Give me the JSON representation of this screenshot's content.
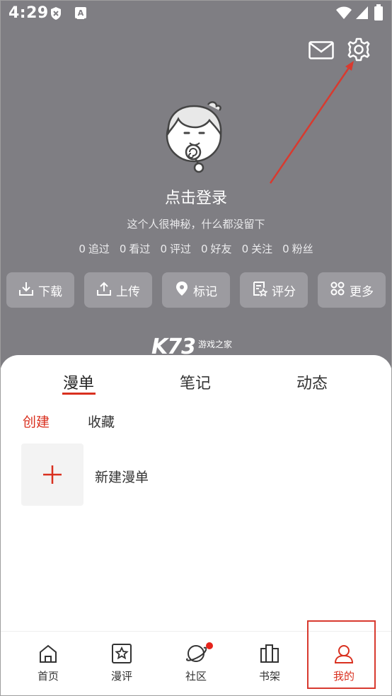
{
  "status_bar": {
    "time": "4:29",
    "icons": [
      "shield-x-icon",
      "a-keyboard-icon",
      "wifi-icon",
      "signal-icon",
      "battery-icon"
    ]
  },
  "header_icons": [
    "mail-icon",
    "settings-gear-icon"
  ],
  "profile": {
    "login_label": "点击登录",
    "bio": "这个人很神秘，什么都没留下"
  },
  "stats": [
    {
      "count": "0",
      "label": "追过"
    },
    {
      "count": "0",
      "label": "看过"
    },
    {
      "count": "0",
      "label": "评过"
    },
    {
      "count": "0",
      "label": "好友"
    },
    {
      "count": "0",
      "label": "关注"
    },
    {
      "count": "0",
      "label": "粉丝"
    }
  ],
  "actions": [
    {
      "label": "下载",
      "icon": "download-icon"
    },
    {
      "label": "上传",
      "icon": "upload-icon"
    },
    {
      "label": "标记",
      "icon": "location-pin-icon"
    },
    {
      "label": "评分",
      "icon": "rate-note-icon"
    },
    {
      "label": "更多",
      "icon": "more-grid-icon"
    }
  ],
  "watermark": {
    "brand": "K73",
    "tagline": "游戏之家"
  },
  "content_tabs": {
    "tabs": [
      "漫单",
      "笔记",
      "动态"
    ],
    "active": "漫单"
  },
  "sub_tabs": {
    "items": [
      "创建",
      "收藏"
    ],
    "active": "创建"
  },
  "create_item": {
    "label": "新建漫单",
    "icon": "plus-icon"
  },
  "bottom_nav": {
    "items": [
      {
        "label": "首页",
        "icon": "home-icon"
      },
      {
        "label": "漫评",
        "icon": "star-review-icon"
      },
      {
        "label": "社区",
        "icon": "planet-icon",
        "badge": true
      },
      {
        "label": "书架",
        "icon": "bookshelf-icon"
      },
      {
        "label": "我的",
        "icon": "user-icon"
      }
    ],
    "active": "我的"
  },
  "colors": {
    "header_bg": "#7f7e83",
    "accent_red": "#d9301f",
    "annotation_red": "#d83a2f",
    "action_button_bg": "#9c9ba0"
  }
}
